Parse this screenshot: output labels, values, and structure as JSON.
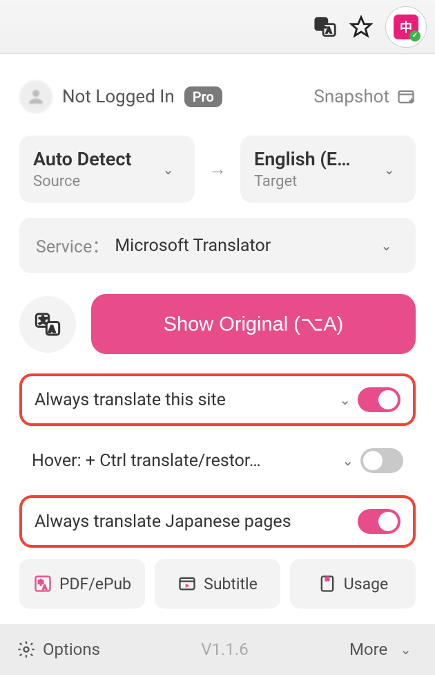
{
  "header": {
    "login_text": "Not Logged In",
    "pro_label": "Pro",
    "snapshot_label": "Snapshot"
  },
  "languages": {
    "source": {
      "title": "Auto Detect",
      "sub": "Source"
    },
    "target": {
      "title": "English (E…",
      "sub": "Target"
    }
  },
  "service": {
    "label": "Service：",
    "name": "Microsoft Translator"
  },
  "main_button": "Show Original (⌥A)",
  "settings": {
    "always_site": {
      "text": "Always translate this site",
      "on": true
    },
    "hover": {
      "text": "Hover:  + Ctrl translate/restor…",
      "on": false
    },
    "always_lang": {
      "text": "Always translate Japanese pages",
      "on": true
    }
  },
  "tools": {
    "pdf": "PDF/ePub",
    "subtitle": "Subtitle",
    "usage": "Usage"
  },
  "footer": {
    "options": "Options",
    "version": "V1.1.6",
    "more": "More"
  }
}
